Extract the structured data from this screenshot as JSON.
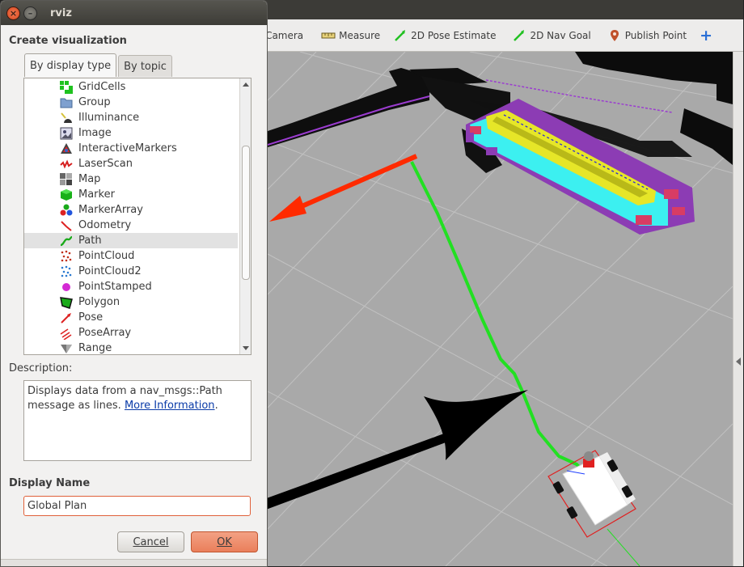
{
  "dialog": {
    "title": "rviz",
    "close_glyph": "×",
    "minimize_glyph": "–",
    "create_heading": "Create visualization",
    "tabs": [
      {
        "label": "By display type",
        "active": true
      },
      {
        "label": "By topic",
        "active": false
      }
    ],
    "display_types": [
      {
        "label": "GridCells",
        "icon": "gridcells-icon",
        "selected": false
      },
      {
        "label": "Group",
        "icon": "folder-icon",
        "selected": false
      },
      {
        "label": "Illuminance",
        "icon": "illuminance-icon",
        "selected": false
      },
      {
        "label": "Image",
        "icon": "image-icon",
        "selected": false
      },
      {
        "label": "InteractiveMarkers",
        "icon": "interactive-markers-icon",
        "selected": false
      },
      {
        "label": "LaserScan",
        "icon": "laserscan-icon",
        "selected": false
      },
      {
        "label": "Map",
        "icon": "map-icon",
        "selected": false
      },
      {
        "label": "Marker",
        "icon": "marker-icon",
        "selected": false
      },
      {
        "label": "MarkerArray",
        "icon": "marker-array-icon",
        "selected": false
      },
      {
        "label": "Odometry",
        "icon": "odometry-icon",
        "selected": false
      },
      {
        "label": "Path",
        "icon": "path-icon",
        "selected": true
      },
      {
        "label": "PointCloud",
        "icon": "pointcloud-icon",
        "selected": false
      },
      {
        "label": "PointCloud2",
        "icon": "pointcloud2-icon",
        "selected": false
      },
      {
        "label": "PointStamped",
        "icon": "point-stamped-icon",
        "selected": false
      },
      {
        "label": "Polygon",
        "icon": "polygon-icon",
        "selected": false
      },
      {
        "label": "Pose",
        "icon": "pose-icon",
        "selected": false
      },
      {
        "label": "PoseArray",
        "icon": "pose-array-icon",
        "selected": false
      },
      {
        "label": "Range",
        "icon": "range-icon",
        "selected": false
      }
    ],
    "description_heading": "Description:",
    "description_text": "Displays data from a nav_msgs::Path message as lines.",
    "description_link": "More Information",
    "description_end": ".",
    "display_name_heading": "Display Name",
    "display_name_value": "Global Plan",
    "cancel_label": "Cancel",
    "ok_label": "OK"
  },
  "toolbar": {
    "items": [
      {
        "label": "s Camera",
        "icon": "camera-icon"
      },
      {
        "label": "Measure",
        "icon": "ruler-icon"
      },
      {
        "label": "2D Pose Estimate",
        "icon": "pose-estimate-icon"
      },
      {
        "label": "2D Nav Goal",
        "icon": "nav-goal-icon"
      },
      {
        "label": "Publish Point",
        "icon": "map-pin-icon"
      }
    ],
    "add_glyph": "+"
  },
  "colors": {
    "view_background": "#a9a9a9",
    "path_line": "#22e022",
    "costmap_cyan": "#3cf0f0",
    "costmap_purple": "#8c3cb4",
    "costmap_yellow": "#e6e628",
    "arrow_red": "#ff2a00",
    "ok_button": "#ea7f5b",
    "input_border": "#e0613a"
  }
}
